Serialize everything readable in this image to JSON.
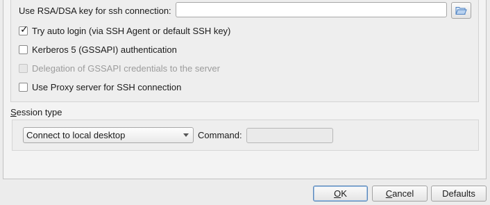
{
  "ssh": {
    "key_label": "Use RSA/DSA key for ssh connection:",
    "key_value": "",
    "browse_icon": "folder-open-icon",
    "options": [
      {
        "label": "Try auto login (via SSH Agent or default SSH key)",
        "checked": true,
        "enabled": true
      },
      {
        "label": "Kerberos 5 (GSSAPI) authentication",
        "checked": false,
        "enabled": true
      },
      {
        "label": "Delegation of GSSAPI credentials to the server",
        "checked": false,
        "enabled": false
      },
      {
        "label": "Use Proxy server for SSH connection",
        "checked": false,
        "enabled": true
      }
    ]
  },
  "session": {
    "title_mnemonic": "S",
    "title_rest": "ession type",
    "selected": "Connect to local desktop",
    "command_label": "Command:",
    "command_value": ""
  },
  "buttons": {
    "ok_mnemonic": "O",
    "ok_rest": "K",
    "cancel_mnemonic": "C",
    "cancel_rest": "ancel",
    "defaults": "Defaults"
  },
  "colors": {
    "window_bg": "#ececec",
    "panel_bg": "#f3f3f3",
    "folder_icon": "#4a7fc1",
    "default_button_border": "#5b87b8"
  }
}
